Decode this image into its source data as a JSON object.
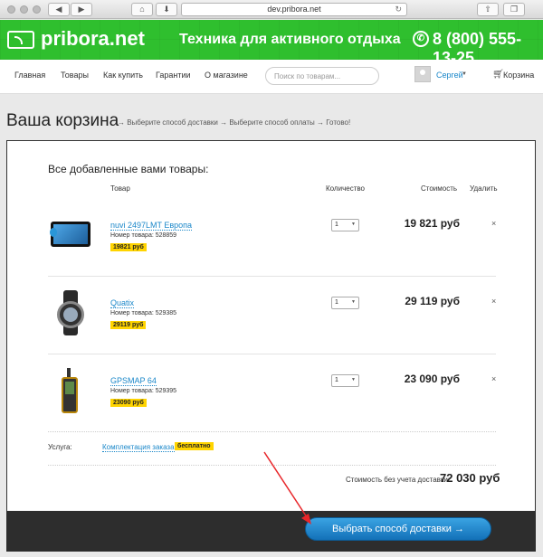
{
  "browser": {
    "url": "dev.pribora.net"
  },
  "header": {
    "logo": "pribora.net",
    "slogan": "Техника для активного отдыха",
    "phone": "8 (800) 555-13-25",
    "brand_color": "#2fbf2e"
  },
  "nav": {
    "items": [
      "Главная",
      "Товары",
      "Как купить",
      "Гарантии",
      "О магазине"
    ],
    "search_placeholder": "Поиск по товарам...",
    "user": "Сергей",
    "cart": "Корзина"
  },
  "page": {
    "title": "Ваша корзина",
    "steps": "→ Выберите способ доставки → Выберите способ оплаты → Готово!"
  },
  "cart": {
    "heading": "Все добавленные вами товары:",
    "columns": {
      "product": "Товар",
      "quantity": "Количество",
      "cost": "Стоимость",
      "delete": "Удалить"
    },
    "items": [
      {
        "name": "nuvi 2497LMT Европа",
        "sku": "Номер товара: 528859",
        "price_badge": "19821 руб",
        "qty": "1",
        "cost": "19 821 руб",
        "icon": "gps-navigator-icon"
      },
      {
        "name": "Quatix",
        "sku": "Номер товара: 529385",
        "price_badge": "29119 руб",
        "qty": "1",
        "cost": "29 119 руб",
        "icon": "watch-icon"
      },
      {
        "name": "GPSMAP 64",
        "sku": "Номер товара: 529395",
        "price_badge": "23090 руб",
        "qty": "1",
        "cost": "23 090 руб",
        "icon": "handheld-gps-icon"
      }
    ],
    "delete_symbol": "×",
    "service": {
      "label": "Услуга:",
      "link": "Комплектация заказа",
      "badge": "бесплатно"
    },
    "total_label": "Стоимость без учета доставки:",
    "total_value": "72 030 руб"
  },
  "cta": {
    "label": "Выбрать способ доставки →",
    "color": "#1a87c9"
  },
  "annotation": {
    "arrow_color": "#e8262a"
  }
}
